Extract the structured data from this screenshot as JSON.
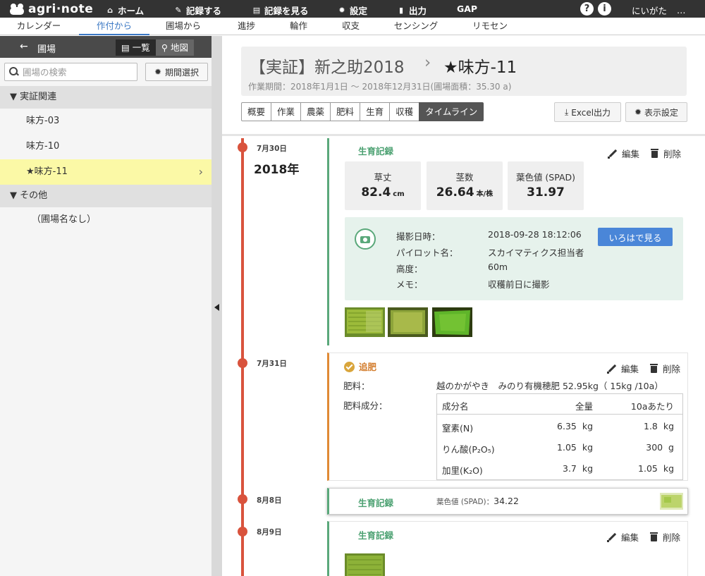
{
  "app": {
    "logo": "agri·note"
  },
  "topnav": {
    "home": "ホーム",
    "record": "記録する",
    "view": "記録を見る",
    "settings": "設定",
    "output": "出力",
    "gap": "GAP",
    "user": "にいがた",
    "more": "…",
    "help_icon": "?",
    "info_icon": "i"
  },
  "subnav": [
    "カレンダー",
    "作付から",
    "圃場から",
    "進捗",
    "輪作",
    "収支",
    "センシング",
    "リモセン"
  ],
  "sidebar": {
    "title": "圃場",
    "list_label": "一覧",
    "map_label": "地図",
    "search_placeholder": "圃場の検索",
    "period_label": "期間選択",
    "group1": "▼ 実証関連",
    "items": [
      "味方-03",
      "味方-10",
      "★味方-11"
    ],
    "group2": "▼ その他",
    "none_item": "（圃場名なし）"
  },
  "header": {
    "title": "【実証】新之助2018",
    "sep": "›",
    "farm": "★味方-11",
    "period": "作業期間：2018年1月1日 〜 2018年12月31日(圃場面積：35.30 a)",
    "tabs": [
      "概要",
      "作業",
      "農薬",
      "肥料",
      "生育",
      "収穫",
      "タイムライン"
    ],
    "excel": "Excel出力",
    "display": "表示設定"
  },
  "timeline": {
    "year": "2018年",
    "edit": "編集",
    "delete": "削除",
    "e1": {
      "date": "7月30日",
      "type": "生育記録",
      "metrics": [
        {
          "label": "草丈",
          "value": "82.4",
          "unit": "cm"
        },
        {
          "label": "茎数",
          "value": "26.64",
          "unit": "本/株"
        },
        {
          "label": "葉色値 (SPAD)",
          "value": "31.97",
          "unit": ""
        }
      ],
      "photo": {
        "k1": "撮影日時：",
        "v1": "2018-09-28 18:12:06",
        "k2": "パイロット名：",
        "v2": "スカイマティクス担当者",
        "k3": "高度：",
        "v3": "60m",
        "k4": "メモ：",
        "v4": "収穫前日に撮影",
        "button": "いろはで見る"
      }
    },
    "e2": {
      "date": "7月31日",
      "type": "追肥",
      "fert_label": "肥料：",
      "fert_value": "越のかがやき　みのり有機穂肥 52.95kg（ 15kg /10a）",
      "comp_label": "肥料成分：",
      "table_head": [
        "成分名",
        "全量",
        "10aあたり"
      ],
      "rows": [
        {
          "name": "窒素(N)",
          "total": "6.35  kg",
          "per": "1.8  kg"
        },
        {
          "name": "りん酸(P₂O₅)",
          "total": "1.05  kg",
          "per": "300  g"
        },
        {
          "name": "加里(K₂O)",
          "total": "3.7  kg",
          "per": "1.05  kg"
        }
      ]
    },
    "e3": {
      "date": "8月8日",
      "type": "生育記録",
      "summary_label": "葉色値 (SPAD)：",
      "summary_value": "34.22"
    },
    "e4": {
      "date": "8月9日",
      "type": "生育記録"
    }
  },
  "colors": {
    "accent": "#3b78c4",
    "timeline": "#d9533d",
    "green": "#4aa070",
    "orange": "#d27b2a",
    "selected": "#fbf9a6"
  }
}
